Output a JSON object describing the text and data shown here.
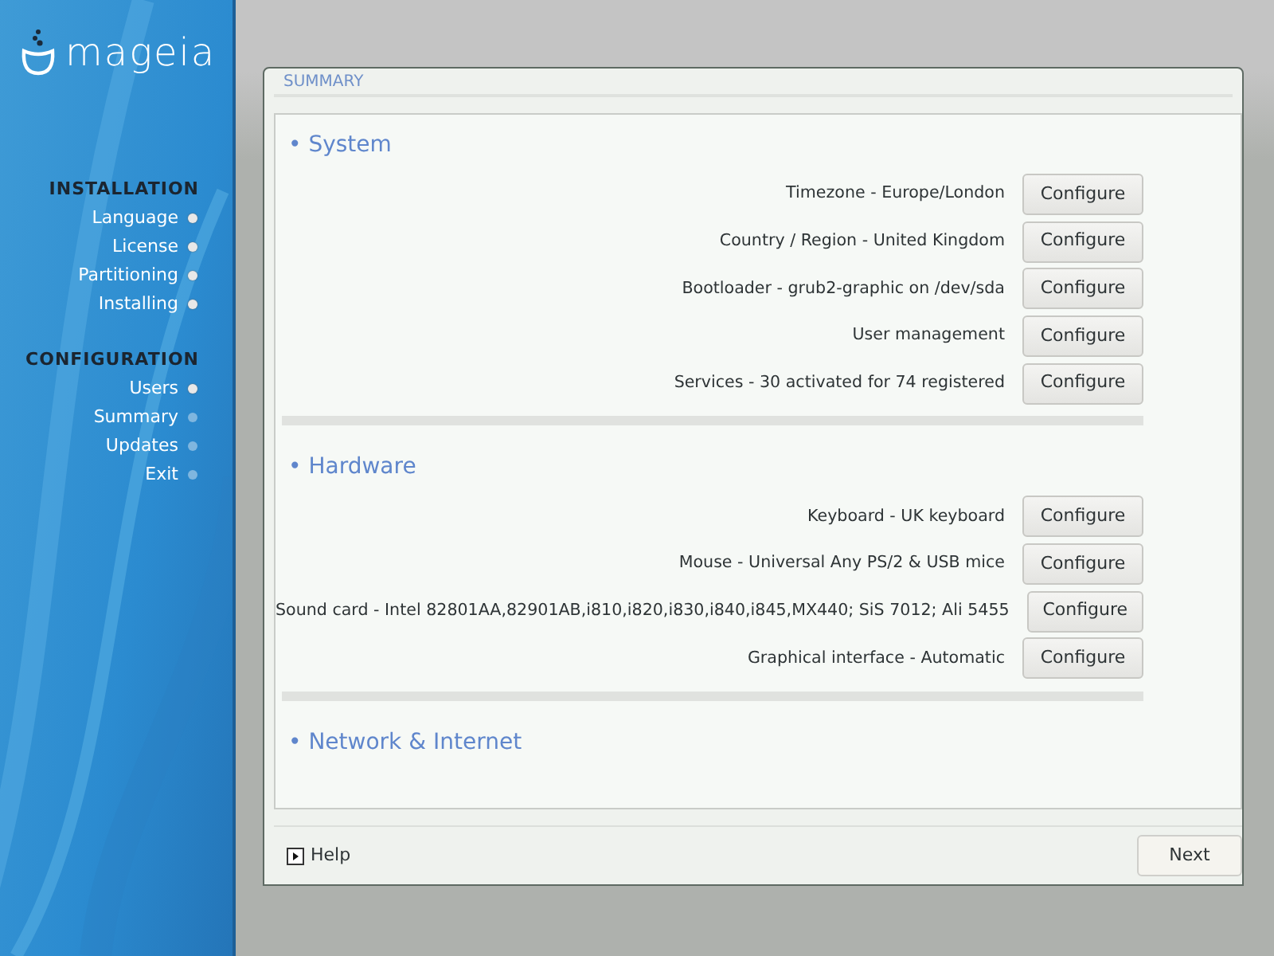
{
  "logo": {
    "text": "mageia"
  },
  "sidebar": {
    "groups": [
      {
        "title": "INSTALLATION",
        "items": [
          {
            "label": "Language",
            "done": true
          },
          {
            "label": "License",
            "done": true
          },
          {
            "label": "Partitioning",
            "done": true
          },
          {
            "label": "Installing",
            "done": true
          }
        ]
      },
      {
        "title": "CONFIGURATION",
        "items": [
          {
            "label": "Users",
            "done": true
          },
          {
            "label": "Summary",
            "done": false
          },
          {
            "label": "Updates",
            "done": false
          },
          {
            "label": "Exit",
            "done": false
          }
        ]
      }
    ]
  },
  "dialog": {
    "title": "SUMMARY",
    "sections": [
      {
        "title": "• System",
        "rows": [
          {
            "label": "Timezone - Europe/London",
            "button": "Configure"
          },
          {
            "label": "Country / Region - United Kingdom",
            "button": "Configure"
          },
          {
            "label": "Bootloader - grub2-graphic on /dev/sda",
            "button": "Configure"
          },
          {
            "label": "User management",
            "button": "Configure"
          },
          {
            "label": "Services - 30 activated for 74 registered",
            "button": "Configure"
          }
        ]
      },
      {
        "title": "• Hardware",
        "rows": [
          {
            "label": "Keyboard - UK keyboard",
            "button": "Configure"
          },
          {
            "label": "Mouse - Universal Any PS/2 & USB mice",
            "button": "Configure"
          },
          {
            "label": "Sound card - Intel 82801AA,82901AB,i810,i820,i830,i840,i845,MX440; SiS 7012; Ali 5455",
            "button": "Configure"
          },
          {
            "label": "Graphical interface - Automatic",
            "button": "Configure"
          }
        ]
      },
      {
        "title": "• Network & Internet"
      }
    ],
    "help": "Help",
    "next": "Next"
  }
}
